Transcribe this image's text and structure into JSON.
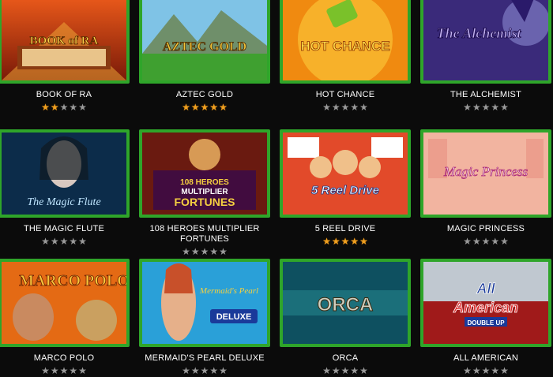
{
  "colors": {
    "border": "#2fa52a",
    "star_on": "#f0a020",
    "star_off": "#9a9a9a",
    "background": "#0b0b0b"
  },
  "games": [
    {
      "title": "BOOK OF RA",
      "rating": 2,
      "logo": "BOOK of RA",
      "icon": "book-of-ra-logo"
    },
    {
      "title": "AZTEC GOLD",
      "rating": 5,
      "logo": "AZTEC GOLD",
      "icon": "aztec-gold-logo"
    },
    {
      "title": "HOT CHANCE",
      "rating": 0,
      "logo": "HOT CHANCE",
      "icon": "hot-chance-logo"
    },
    {
      "title": "THE ALCHEMIST",
      "rating": 0,
      "logo": "The Alchemist",
      "icon": "alchemist-logo"
    },
    {
      "title": "THE MAGIC FLUTE",
      "rating": 0,
      "logo": "The Magic Flute",
      "icon": "magic-flute-logo"
    },
    {
      "title": "108 HEROES MULTIPLIER FORTUNES",
      "rating": 0,
      "logo": "108 HEROES MULTIPLIER FORTUNES",
      "icon": "108-heroes-logo"
    },
    {
      "title": "5 REEL DRIVE",
      "rating": 5,
      "logo": "5 Reel Drive",
      "icon": "reel-drive-logo"
    },
    {
      "title": "MAGIC PRINCESS",
      "rating": 0,
      "logo": "Magic Princess",
      "icon": "magic-princess-logo"
    },
    {
      "title": "MARCO POLO",
      "rating": 0,
      "logo": "MARCO POLO",
      "icon": "marco-polo-logo"
    },
    {
      "title": "MERMAID'S PEARL DELUXE",
      "rating": 0,
      "logo": "Mermaid's Pearl DELUXE",
      "icon": "mermaids-pearl-logo"
    },
    {
      "title": "ORCA",
      "rating": 0,
      "logo": "ORCA",
      "icon": "orca-logo"
    },
    {
      "title": "ALL AMERICAN",
      "rating": 0,
      "logo": "All American DOUBLE UP",
      "icon": "all-american-logo"
    }
  ]
}
